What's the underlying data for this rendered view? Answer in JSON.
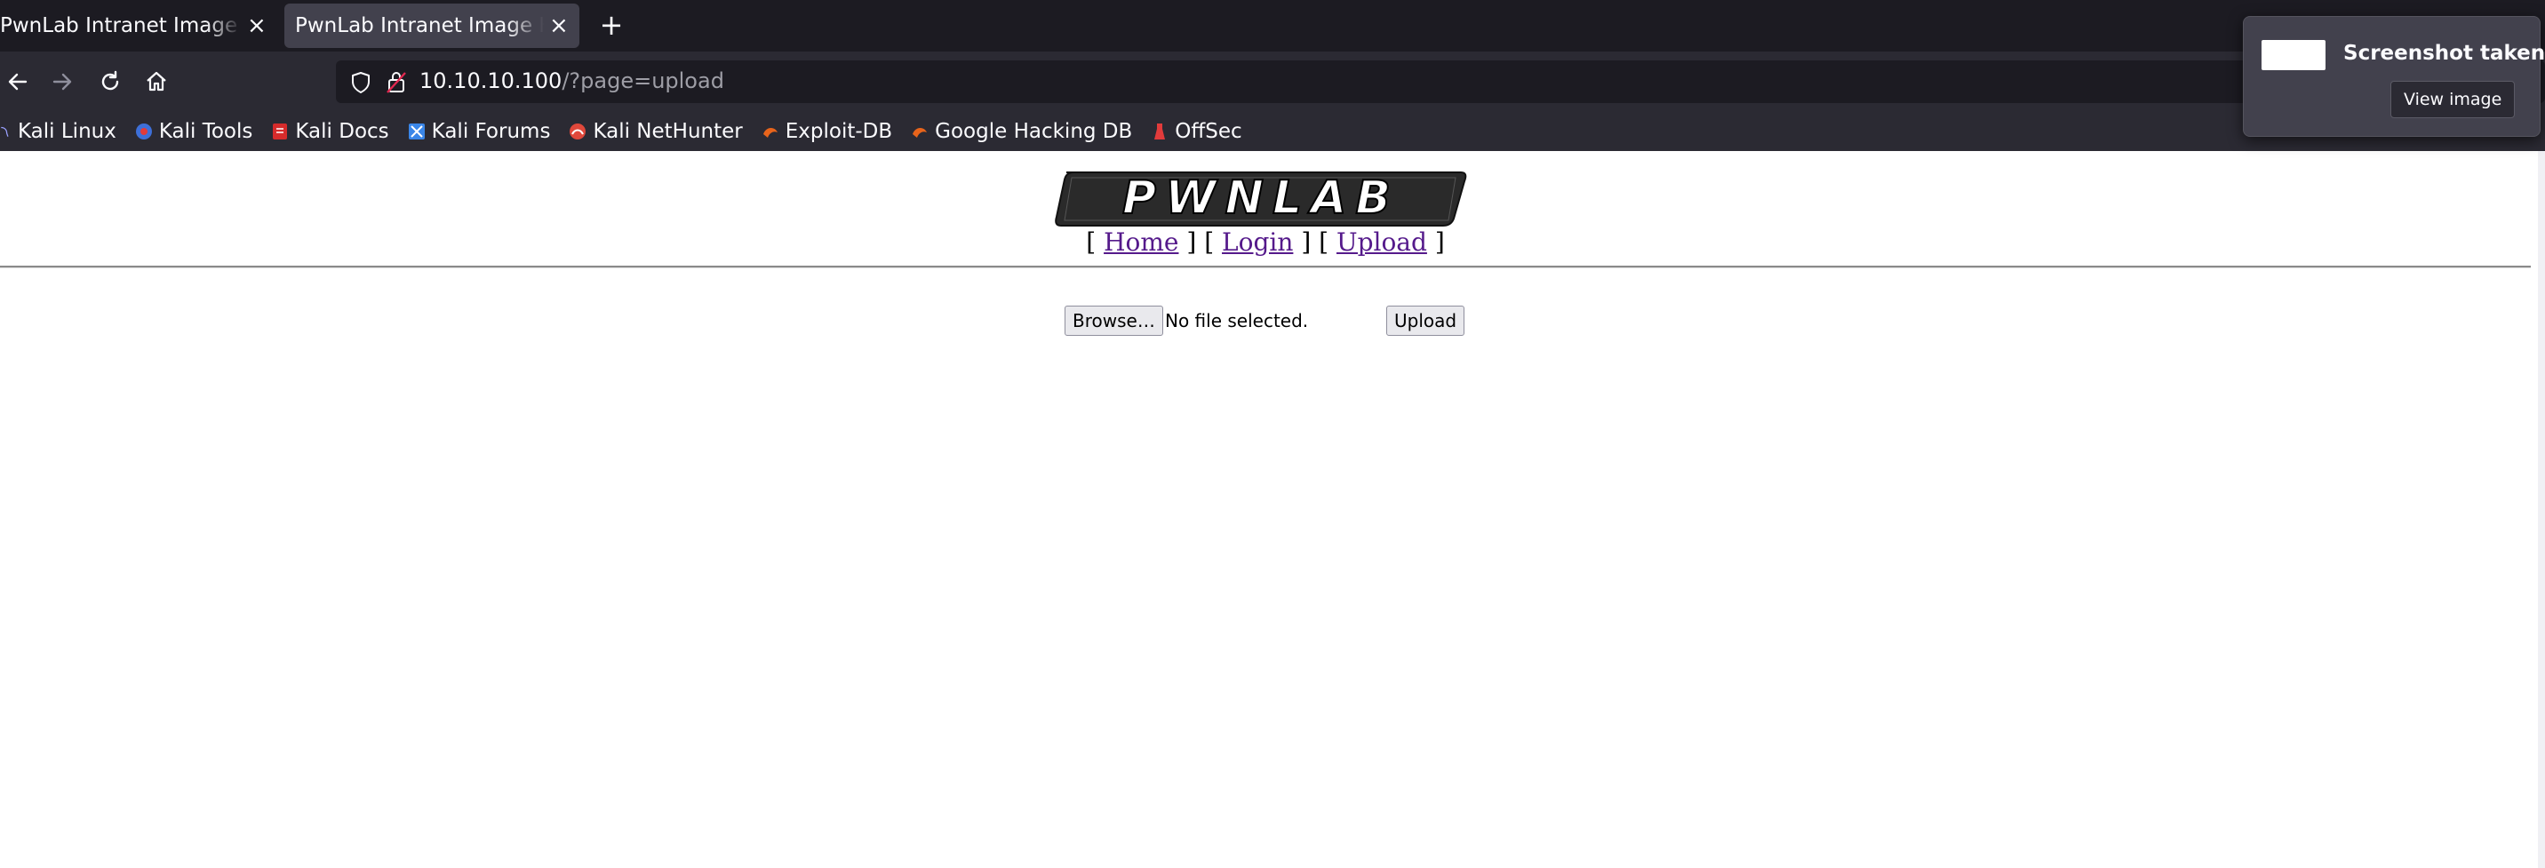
{
  "browser": {
    "tabs": [
      {
        "title": "PwnLab Intranet Image Hosting",
        "close": "×"
      },
      {
        "title": "PwnLab Intranet Image Hosting",
        "close": "×"
      }
    ],
    "new_tab": "+",
    "url": {
      "host": "10.10.10.100",
      "path": "/?page=upload"
    },
    "bookmarks": [
      {
        "label": "Kali Linux",
        "icon": "kali-dragon-icon",
        "color": "#9aa0ff"
      },
      {
        "label": "Kali Tools",
        "icon": "kali-tools-icon",
        "color": "#3e6fd8"
      },
      {
        "label": "Kali Docs",
        "icon": "kali-docs-icon",
        "color": "#d62b2b"
      },
      {
        "label": "Kali Forums",
        "icon": "kali-forums-icon",
        "color": "#3a86e8"
      },
      {
        "label": "Kali NetHunter",
        "icon": "nethunter-icon",
        "color": "#e0483b"
      },
      {
        "label": "Exploit-DB",
        "icon": "exploit-db-icon",
        "color": "#e8641b"
      },
      {
        "label": "Google Hacking DB",
        "icon": "ghdb-icon",
        "color": "#e8641b"
      },
      {
        "label": "OffSec",
        "icon": "offsec-icon",
        "color": "#e23b3b"
      }
    ]
  },
  "page": {
    "logo_text": "PWNLAB",
    "nav": {
      "open": "[",
      "sep": "] [",
      "close": "]",
      "home": "Home",
      "login": "Login",
      "upload": "Upload"
    },
    "form": {
      "browse_label": "Browse…",
      "file_status": "No file selected.",
      "upload_label": "Upload"
    }
  },
  "notification": {
    "title": "Screenshot taken",
    "button": "View image"
  },
  "colors": {
    "tabbar": "#1c1b22",
    "toolbar": "#2b2a33",
    "active_tab": "#42414d",
    "visited_link": "#551a8b"
  }
}
